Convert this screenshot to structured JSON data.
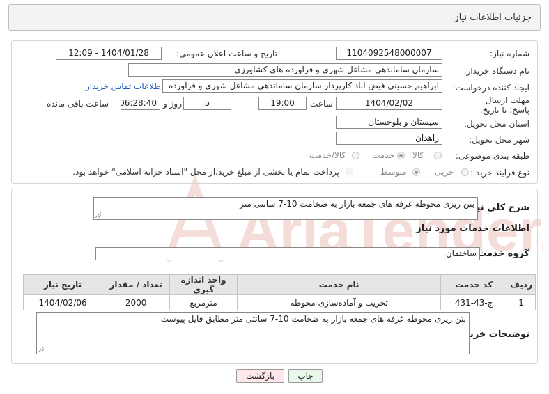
{
  "header": {
    "title": "جزئیات اطلاعات نیاز"
  },
  "watermark": {
    "text": "AriaTender.neT",
    "color": "#e8b7b0"
  },
  "labels": {
    "need_number": "شماره نیاز:",
    "announce_datetime": "تاریخ و ساعت اعلان عمومی:",
    "buyer_org": "نام دستگاه خریدار:",
    "requester": "ایجاد کننده درخواست:",
    "deadline": "مهلت ارسال پاسخ: تا تاریخ:",
    "hour": "ساعت",
    "days_and": "روز و",
    "hours_remaining": "ساعت باقی مانده",
    "province": "استان محل تحویل:",
    "city": "شهر محل تحویل:",
    "category": "طبقه بندی موضوعی:",
    "purchase_type": "نوع فرآیند خرید :",
    "general_desc": "شرح کلی نیاز:",
    "services_info": "اطلاعات خدمات مورد نیاز",
    "service_group": "گروه خدمت:",
    "buyer_notes": "توضیحات خریدار:"
  },
  "values": {
    "need_number": "1104092548000007",
    "announce_datetime": "1404/01/28 - 12:09",
    "buyer_org": "سازمان ساماندهی مشاغل شهری و فرآورده های کشاورزی",
    "requester": "ابراهیم حسینی فیض آباد کارپرداز سازمان ساماندهی مشاغل شهری و فرآورده",
    "deadline_date": "1404/02/02",
    "deadline_time": "19:00",
    "days": "5",
    "remaining_time": "06:28:40",
    "province": "سیستان و بلوچستان",
    "city": "زاهدان",
    "general_desc": "بتن ریزی محوطه غرفه های جمعه بازار به ضخامت 10-7 سانتی متر",
    "service_group": "ساختمان",
    "buyer_notes": "بتن ریزی محوطه غرفه های جمعه بازار به ضخامت 10-7 سانتی متر مطابق فایل پیوست"
  },
  "links": {
    "buyer_contact": "اطلاعات تماس خریدار"
  },
  "category_options": {
    "goods": "کالا",
    "service": "خدمت",
    "goods_service": "کالا/خدمت",
    "selected": "service"
  },
  "purchase_options": {
    "partial": "جزیی",
    "medium": "متوسط",
    "selected": "medium",
    "treasury_note": "پرداخت تمام یا بخشی از مبلغ خرید،از محل \"اسناد خزانه اسلامی\" خواهد بود."
  },
  "table": {
    "headers": [
      "ردیف",
      "کد خدمت",
      "نام خدمت",
      "واحد اندازه گیری",
      "تعداد / مقدار",
      "تاریخ نیاز"
    ],
    "rows": [
      [
        "1",
        "ج-43-431",
        "تخریب و آماده‌سازی محوطه",
        "مترمربع",
        "2000",
        "1404/02/06"
      ]
    ]
  },
  "buttons": {
    "print": "چاپ",
    "back": "بازگشت"
  }
}
